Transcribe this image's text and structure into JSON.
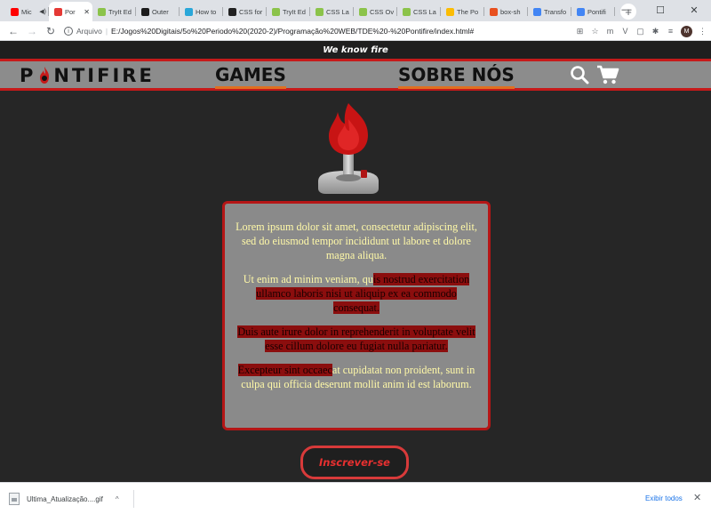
{
  "browser": {
    "tabs": [
      {
        "title": "Mic",
        "extra": "◀)",
        "fav_color": "#ff0000",
        "active": false
      },
      {
        "title": "Por",
        "extra": "",
        "fav_color": "#e53935",
        "active": true
      },
      {
        "title": "TryIt Ed",
        "extra": "",
        "fav_color": "#8bc34a",
        "active": false
      },
      {
        "title": "Outer",
        "extra": "",
        "fav_color": "#1c1c1c",
        "active": false
      },
      {
        "title": "How to",
        "extra": "",
        "fav_color": "#2aa7d9",
        "active": false
      },
      {
        "title": "CSS for",
        "extra": "",
        "fav_color": "#222222",
        "active": false
      },
      {
        "title": "TryIt Ed",
        "extra": "",
        "fav_color": "#8bc34a",
        "active": false
      },
      {
        "title": "CSS La",
        "extra": "",
        "fav_color": "#8bc34a",
        "active": false
      },
      {
        "title": "CSS Ov",
        "extra": "",
        "fav_color": "#8bc34a",
        "active": false
      },
      {
        "title": "CSS La",
        "extra": "",
        "fav_color": "#8bc34a",
        "active": false
      },
      {
        "title": "The Po",
        "extra": "",
        "fav_color": "#fbbc04",
        "active": false
      },
      {
        "title": "box-sh",
        "extra": "",
        "fav_color": "#e8501f",
        "active": false
      },
      {
        "title": "Transfo",
        "extra": "",
        "fav_color": "#4285f4",
        "active": false
      },
      {
        "title": "Pontifi",
        "extra": "",
        "fav_color": "#4285f4",
        "active": false
      }
    ],
    "new_tab_symbol": "+",
    "window_controls": {
      "minimize": "—",
      "maximize": "☐",
      "close": "✕"
    },
    "nav": {
      "back": "←",
      "forward": "→",
      "reload": "↻"
    },
    "address": {
      "prefix": "Arquivo",
      "separator": "|",
      "url": "E:/Jogos%20Digitais/5o%20Periodo%20(2020-2)/Programação%20WEB/TDE%20-%20Pontifire/index.html#"
    },
    "extensions": [
      {
        "name": "translate-icon",
        "glyph": "⊞"
      },
      {
        "name": "star-icon",
        "glyph": "☆"
      },
      {
        "name": "m-extension-icon",
        "glyph": "m"
      },
      {
        "name": "v-extension-icon",
        "glyph": "V"
      },
      {
        "name": "pocket-icon",
        "glyph": "▢"
      },
      {
        "name": "puzzle-icon",
        "glyph": "✱"
      },
      {
        "name": "queue-icon",
        "glyph": "≡"
      },
      {
        "name": "avatar",
        "glyph": "M"
      },
      {
        "name": "menu-icon",
        "glyph": "⋮"
      }
    ]
  },
  "site": {
    "banner": "We know fire",
    "logo_left": "P",
    "logo_right": "NTIFIRE",
    "menu": {
      "games": "GAMES",
      "about": "SOBRE NÓS"
    },
    "paragraphs": {
      "p1": "Lorem ipsum dolor sit amet, consectetur adipiscing elit, sed do eiusmod tempor incididunt ut labore et dolore magna aliqua.",
      "p2_normal": "Ut enim ad minim veniam, qu",
      "p2_highlight": "is nostrud exercitation ullamco laboris nisi ut aliquip ex ea commodo consequat.",
      "p3_highlight": "Duis aute irure dolor in reprehenderit in voluptate velit esse cillum dolore eu fugiat nulla pariatur.",
      "p4_highlight": "Excepteur sint occaec",
      "p4_normal": "at cupidatat non proident, sunt in culpa qui officia deserunt mollit anim id est laborum."
    },
    "cta_label": "Inscrever-se",
    "colors": {
      "accent_red": "#c61a1a",
      "nav_gray": "#8c8c8c",
      "text_yellow": "#fff9a8",
      "underline_orange": "#e07020"
    }
  },
  "downloads": {
    "file_name": "Ultima_Atualização....gif",
    "chevron": "^",
    "show_all": "Exibir todos",
    "close": "✕"
  }
}
